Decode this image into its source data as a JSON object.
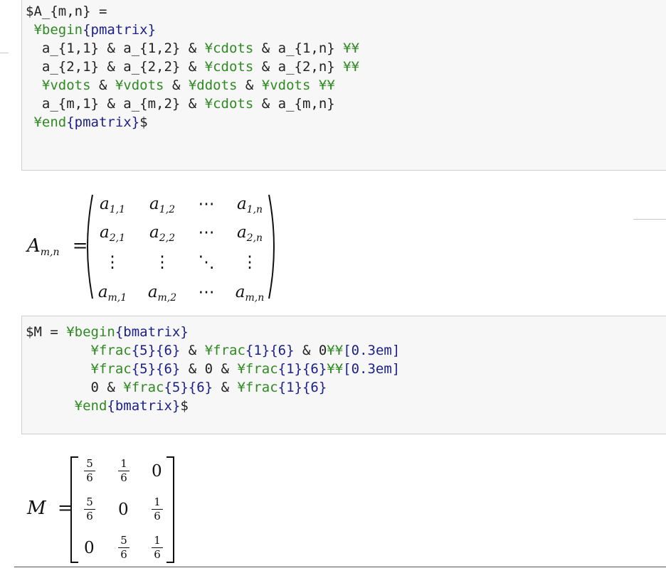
{
  "cell1": {
    "code_lines": [
      [
        {
          "t": "$A_{m,n} =",
          "c": ""
        }
      ],
      [
        {
          "t": " ¥begin",
          "c": "kw"
        },
        {
          "t": "{pmatrix}",
          "c": "arg"
        }
      ],
      [
        {
          "t": "  a_{1,1} & a_{1,2} & ",
          "c": ""
        },
        {
          "t": "¥cdots",
          "c": "kw"
        },
        {
          "t": " & a_{1,n} ",
          "c": ""
        },
        {
          "t": "¥¥",
          "c": "kw"
        }
      ],
      [
        {
          "t": "  a_{2,1} & a_{2,2} & ",
          "c": ""
        },
        {
          "t": "¥cdots",
          "c": "kw"
        },
        {
          "t": " & a_{2,n} ",
          "c": ""
        },
        {
          "t": "¥¥",
          "c": "kw"
        }
      ],
      [
        {
          "t": "  ",
          "c": ""
        },
        {
          "t": "¥vdots",
          "c": "kw"
        },
        {
          "t": " & ",
          "c": ""
        },
        {
          "t": "¥vdots",
          "c": "kw"
        },
        {
          "t": " & ",
          "c": ""
        },
        {
          "t": "¥ddots",
          "c": "kw"
        },
        {
          "t": " & ",
          "c": ""
        },
        {
          "t": "¥vdots",
          "c": "kw"
        },
        {
          "t": " ",
          "c": ""
        },
        {
          "t": "¥¥",
          "c": "kw"
        }
      ],
      [
        {
          "t": "  a_{m,1} & a_{m,2} & ",
          "c": ""
        },
        {
          "t": "¥cdots",
          "c": "kw"
        },
        {
          "t": " & a_{m,n}",
          "c": ""
        }
      ],
      [
        {
          "t": " ¥end",
          "c": "kw"
        },
        {
          "t": "{pmatrix}",
          "c": "arg"
        },
        {
          "t": "$",
          "c": ""
        }
      ]
    ]
  },
  "output1": {
    "lhs_var": "A",
    "lhs_sub": "m,n",
    "equals": "=",
    "rows": [
      [
        {
          "v": "a",
          "s": "1,1"
        },
        {
          "v": "a",
          "s": "1,2"
        },
        {
          "g": "⋯"
        },
        {
          "v": "a",
          "s": "1,n"
        }
      ],
      [
        {
          "v": "a",
          "s": "2,1"
        },
        {
          "v": "a",
          "s": "2,2"
        },
        {
          "g": "⋯"
        },
        {
          "v": "a",
          "s": "2,n"
        }
      ],
      [
        {
          "g": "⋮"
        },
        {
          "g": "⋮"
        },
        {
          "g": "⋱"
        },
        {
          "g": "⋮"
        }
      ],
      [
        {
          "v": "a",
          "s": "m,1"
        },
        {
          "v": "a",
          "s": "m,2"
        },
        {
          "g": "⋯"
        },
        {
          "v": "a",
          "s": "m,n"
        }
      ]
    ]
  },
  "cell2": {
    "code_lines": [
      [
        {
          "t": "$M = ",
          "c": ""
        },
        {
          "t": "¥begin",
          "c": "kw"
        },
        {
          "t": "{bmatrix}",
          "c": "arg"
        }
      ],
      [
        {
          "t": "        ",
          "c": ""
        },
        {
          "t": "¥frac",
          "c": "kw"
        },
        {
          "t": "{5}{6}",
          "c": "arg"
        },
        {
          "t": " & ",
          "c": ""
        },
        {
          "t": "¥frac",
          "c": "kw"
        },
        {
          "t": "{1}{6}",
          "c": "arg"
        },
        {
          "t": " & 0",
          "c": ""
        },
        {
          "t": "¥¥",
          "c": "kw"
        },
        {
          "t": "[0.3em]",
          "c": "arg"
        }
      ],
      [
        {
          "t": "        ",
          "c": ""
        },
        {
          "t": "¥frac",
          "c": "kw"
        },
        {
          "t": "{5}{6}",
          "c": "arg"
        },
        {
          "t": " & 0 & ",
          "c": ""
        },
        {
          "t": "¥frac",
          "c": "kw"
        },
        {
          "t": "{1}{6}",
          "c": "arg"
        },
        {
          "t": "¥¥",
          "c": "kw"
        },
        {
          "t": "[0.3em]",
          "c": "arg"
        }
      ],
      [
        {
          "t": "        0 & ",
          "c": ""
        },
        {
          "t": "¥frac",
          "c": "kw"
        },
        {
          "t": "{5}{6}",
          "c": "arg"
        },
        {
          "t": " & ",
          "c": ""
        },
        {
          "t": "¥frac",
          "c": "kw"
        },
        {
          "t": "{1}{6}",
          "c": "arg"
        }
      ],
      [
        {
          "t": "      ",
          "c": ""
        },
        {
          "t": "¥end",
          "c": "kw"
        },
        {
          "t": "{bmatrix}",
          "c": "arg"
        },
        {
          "t": "$",
          "c": ""
        }
      ]
    ]
  },
  "output2": {
    "lhs_var": "M",
    "equals": "=",
    "rows": [
      [
        {
          "n": "5",
          "d": "6"
        },
        {
          "n": "1",
          "d": "6"
        },
        {
          "z": "0"
        }
      ],
      [
        {
          "n": "5",
          "d": "6"
        },
        {
          "z": "0"
        },
        {
          "n": "1",
          "d": "6"
        }
      ],
      [
        {
          "z": "0"
        },
        {
          "n": "5",
          "d": "6"
        },
        {
          "n": "1",
          "d": "6"
        }
      ]
    ]
  }
}
